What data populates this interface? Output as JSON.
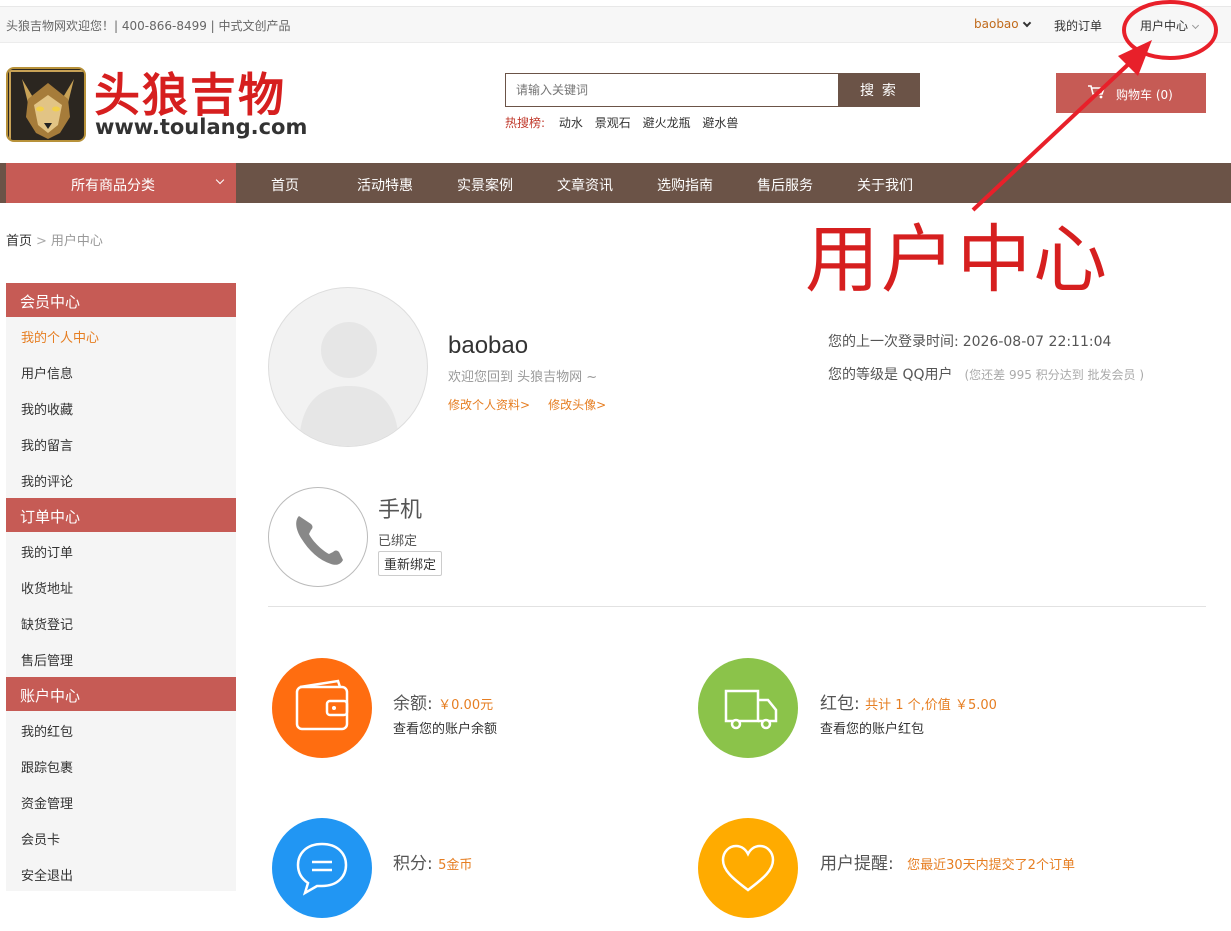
{
  "topbar": {
    "welcome": "头狼吉物网欢迎您！| 400-866-8499 | 中式文创产品",
    "username": "baobao",
    "my_orders": "我的订单",
    "user_center": "用户中心"
  },
  "brand": {
    "title": "头狼吉物",
    "domain": "www.toulang.com"
  },
  "search": {
    "placeholder": "请输入关键词",
    "button": "搜 索",
    "hot_label": "热搜榜:",
    "hot_keywords": [
      "动水",
      "景观石",
      "避火龙瓶",
      "避水兽"
    ]
  },
  "cart": {
    "label": "购物车 (0)"
  },
  "nav": {
    "all_categories": "所有商品分类",
    "items": [
      "首页",
      "活动特惠",
      "实景案例",
      "文章资讯",
      "选购指南",
      "售后服务",
      "关于我们"
    ]
  },
  "breadcrumb": {
    "home": "首页",
    "sep": ">",
    "current": "用户中心"
  },
  "sidebar": {
    "groups": [
      {
        "title": "会员中心",
        "items": [
          "我的个人中心",
          "用户信息",
          "我的收藏",
          "我的留言",
          "我的评论"
        ]
      },
      {
        "title": "订单中心",
        "items": [
          "我的订单",
          "收货地址",
          "缺货登记",
          "售后管理"
        ]
      },
      {
        "title": "账户中心",
        "items": [
          "我的红包",
          "跟踪包裹",
          "资金管理",
          "会员卡",
          "安全退出"
        ]
      }
    ]
  },
  "profile": {
    "username": "baobao",
    "welcome": "欢迎您回到 头狼吉物网 ~",
    "edit_profile": "修改个人资料>",
    "edit_avatar": "修改头像>",
    "last_login_label": "您的上一次登录时间:",
    "last_login_value": "2026-08-07 22:11:04",
    "level_label": "您的等级是 QQ用户",
    "level_note": "(您还差 995 积分达到 批发会员 )"
  },
  "phone": {
    "title": "手机",
    "status": "已绑定",
    "rebind": "重新绑定"
  },
  "stats": {
    "balance": {
      "label": "余额:",
      "value": "￥0.00元",
      "desc": "查看您的账户余额",
      "color": "#ff6d10"
    },
    "redpacket": {
      "label": "红包:",
      "value": "共计 1 个,价值 ￥5.00",
      "desc": "查看您的账户红包",
      "color": "#8bc34a"
    },
    "points": {
      "label": "积分:",
      "value": "5金币",
      "color": "#2196f3"
    },
    "reminder": {
      "label": "用户提醒:",
      "value": "您最近30天内提交了2个订单",
      "color": "#ffab00"
    }
  },
  "annotation": {
    "text": "用户中心",
    "color": "#d61f1f"
  },
  "colors": {
    "brand_red": "#c65b55",
    "nav_brown": "#6b5347",
    "accent_orange": "#e67e22"
  },
  "icons": [
    "wolf-logo-icon",
    "cart-icon",
    "chevron-down-icon",
    "phone-icon",
    "wallet-icon",
    "truck-icon",
    "chat-icon",
    "heart-icon",
    "avatar-placeholder-icon"
  ]
}
